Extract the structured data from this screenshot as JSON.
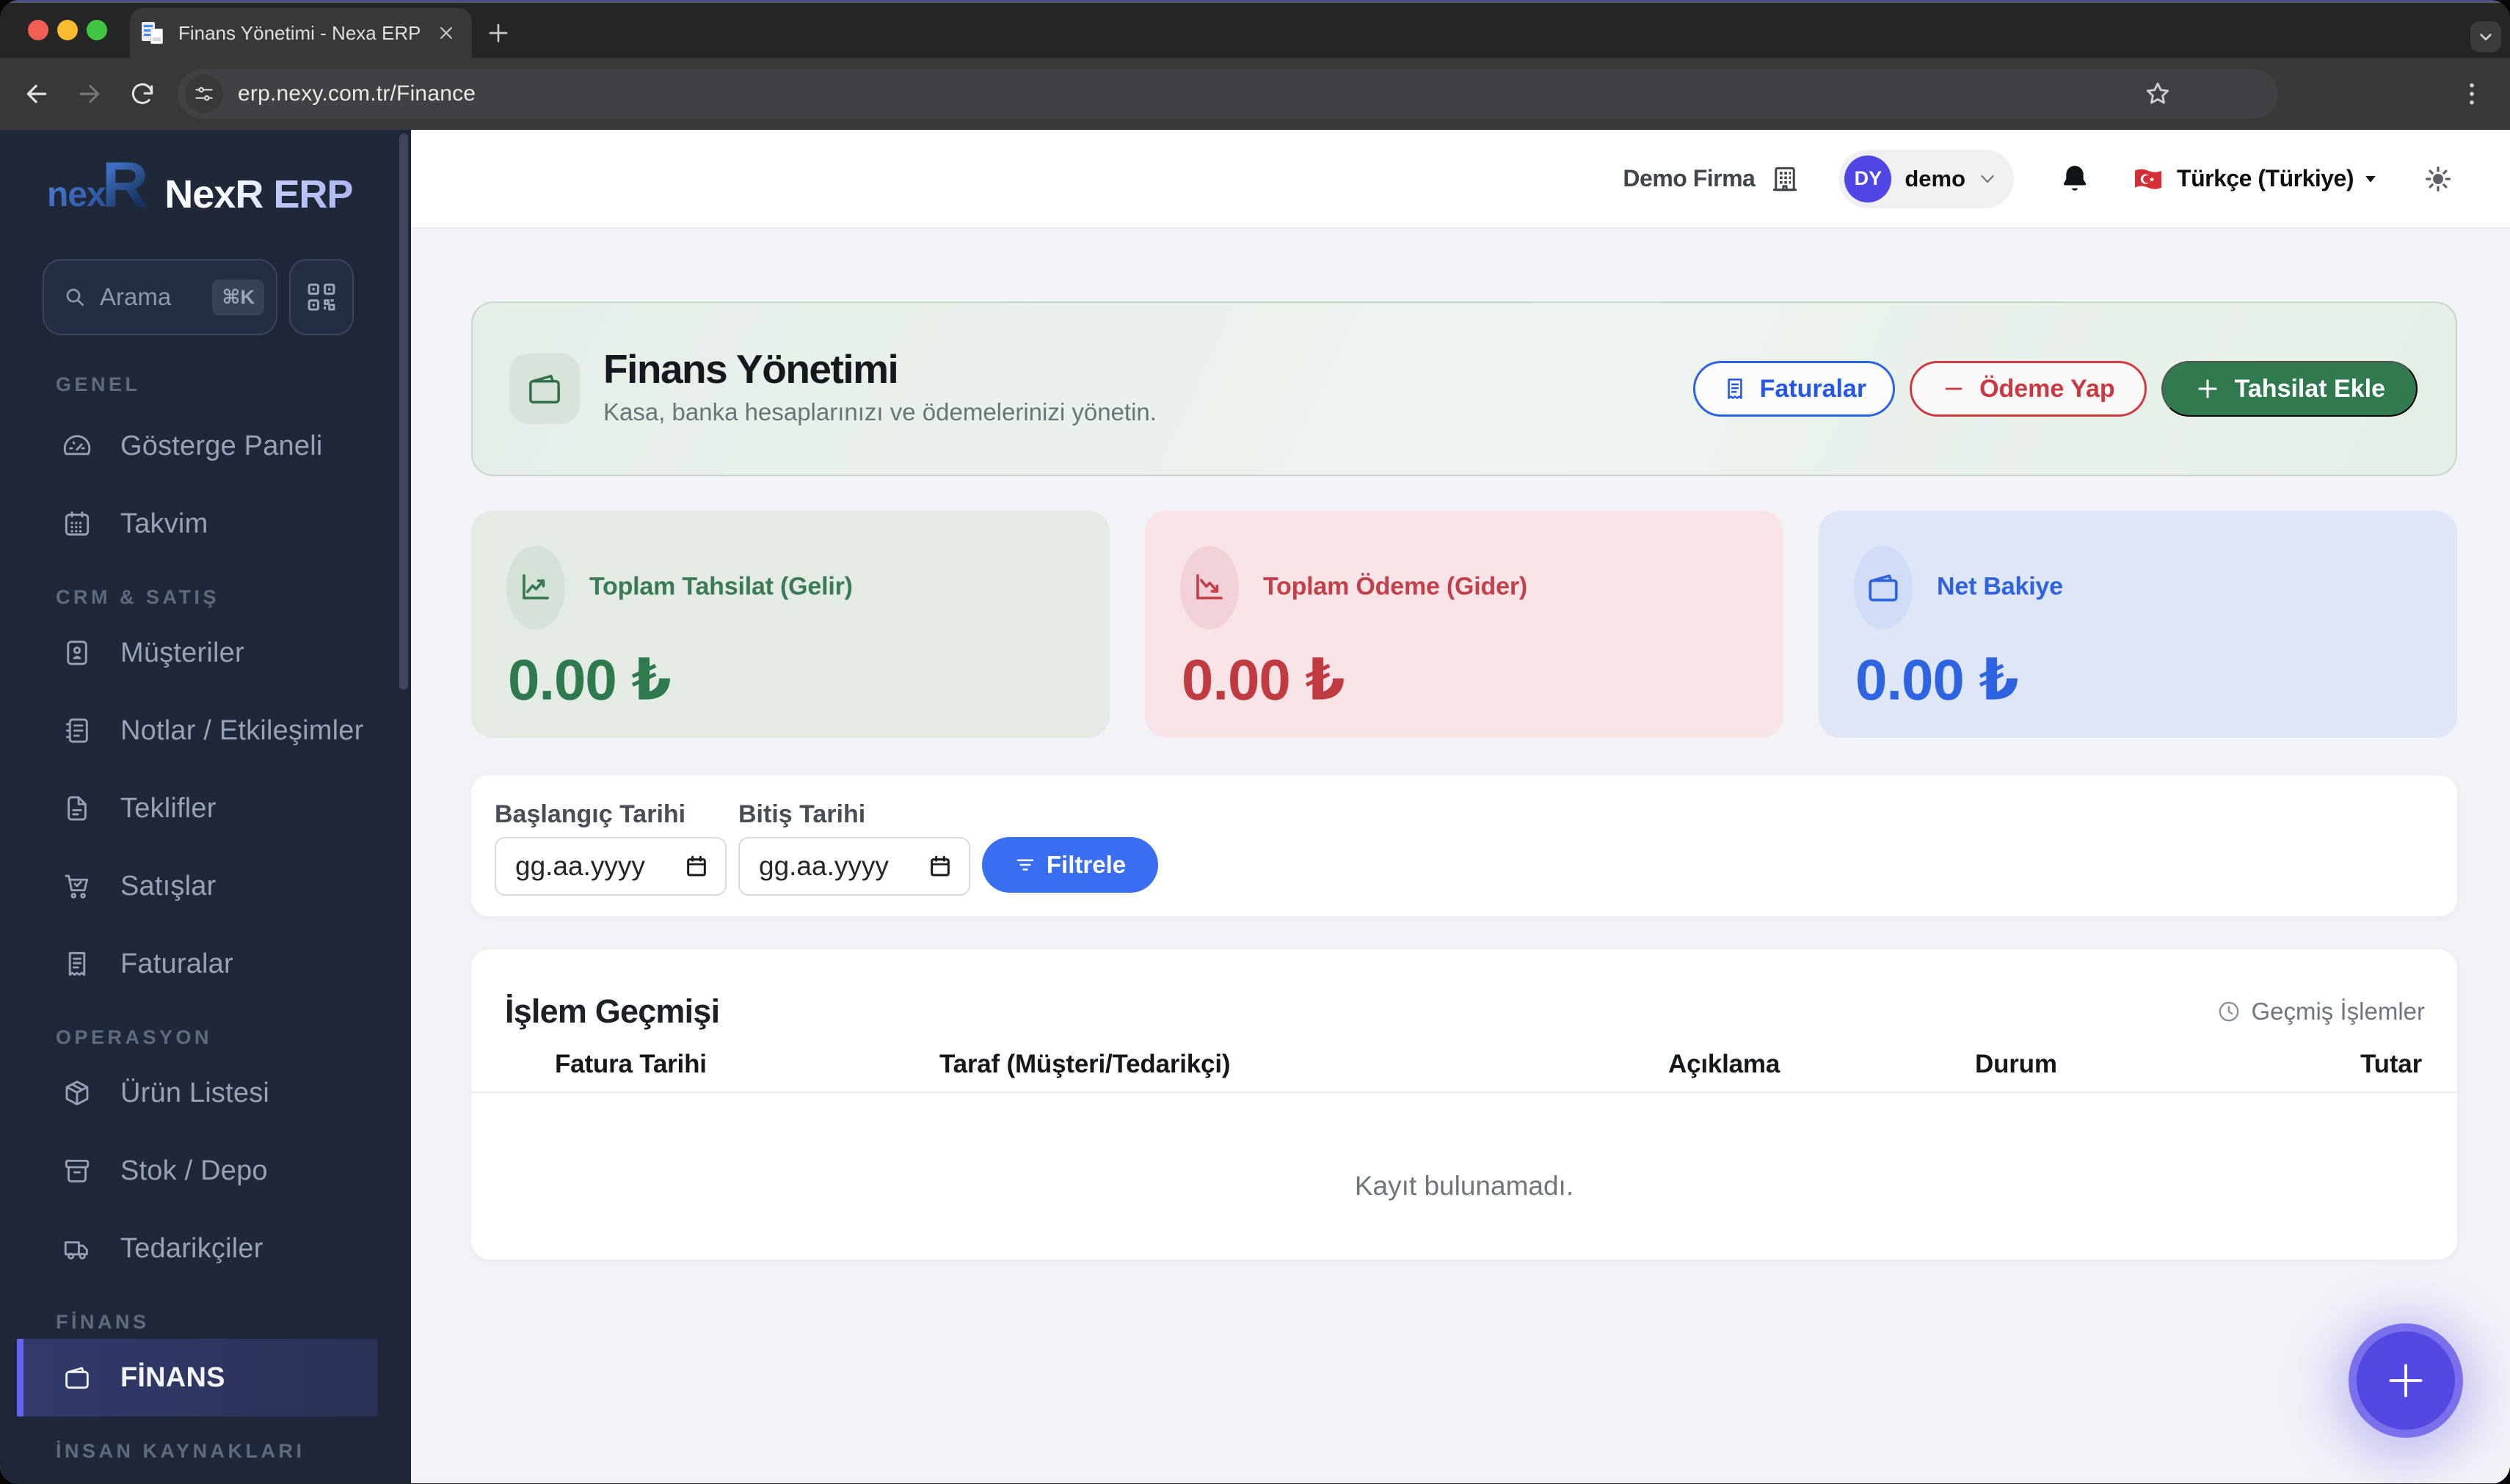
{
  "colors": {
    "accent_indigo": "#4f46e5",
    "sidebar_bg": "#1f2838",
    "green": "#2e7a4e",
    "red": "#c03a42",
    "blue": "#2e63e2",
    "filter_blue": "#3a6ef0",
    "collect_green": "#31794f"
  },
  "browser": {
    "tab_title": "Finans Yönetimi - Nexa ERP",
    "url": "erp.nexy.com.tr/Finance"
  },
  "sidebar": {
    "logo_prefix": "nex",
    "logo_mark": "R",
    "brand_main": "NexR",
    "brand_suffix": "ERP",
    "search": {
      "placeholder": "Arama",
      "shortcut": "⌘K"
    },
    "sections": [
      {
        "label": "GENEL",
        "items": [
          {
            "label": "Gösterge Paneli"
          },
          {
            "label": "Takvim"
          }
        ]
      },
      {
        "label": "CRM & SATIŞ",
        "items": [
          {
            "label": "Müşteriler"
          },
          {
            "label": "Notlar / Etkileşimler"
          },
          {
            "label": "Teklifler"
          },
          {
            "label": "Satışlar"
          },
          {
            "label": "Faturalar"
          }
        ]
      },
      {
        "label": "OPERASYON",
        "items": [
          {
            "label": "Ürün Listesi"
          },
          {
            "label": "Stok / Depo"
          },
          {
            "label": "Tedarikçiler"
          }
        ]
      },
      {
        "label": "FİNANS",
        "items": [
          {
            "label": "FİNANS",
            "active": true
          }
        ]
      },
      {
        "label": "İNSAN KAYNAKLARI",
        "items": []
      }
    ]
  },
  "header": {
    "company": "Demo Firma",
    "user_initials": "DY",
    "user_name": "demo",
    "language": "Türkçe (Türkiye)"
  },
  "hero": {
    "title": "Finans Yönetimi",
    "subtitle": "Kasa, banka hesaplarınızı ve ödemelerinizi yönetin.",
    "invoices_button": "Faturalar",
    "pay_button": "Ödeme Yap",
    "collect_button": "Tahsilat Ekle"
  },
  "stats": [
    {
      "label": "Toplam Tahsilat (Gelir)",
      "value": "0.00 ₺"
    },
    {
      "label": "Toplam Ödeme (Gider)",
      "value": "0.00 ₺"
    },
    {
      "label": "Net Bakiye",
      "value": "0.00 ₺"
    }
  ],
  "filters": {
    "start_label": "Başlangıç Tarihi",
    "end_label": "Bitiş Tarihi",
    "date_placeholder": "gg.aa.yyyy",
    "filter_button": "Filtrele"
  },
  "table": {
    "title": "İşlem Geçmişi",
    "history_label": "Geçmiş İşlemler",
    "columns": [
      "Fatura Tarihi",
      "Taraf (Müşteri/Tedarikçi)",
      "Açıklama",
      "Durum",
      "Tutar"
    ],
    "empty": "Kayıt bulunamadı.",
    "rows": []
  }
}
